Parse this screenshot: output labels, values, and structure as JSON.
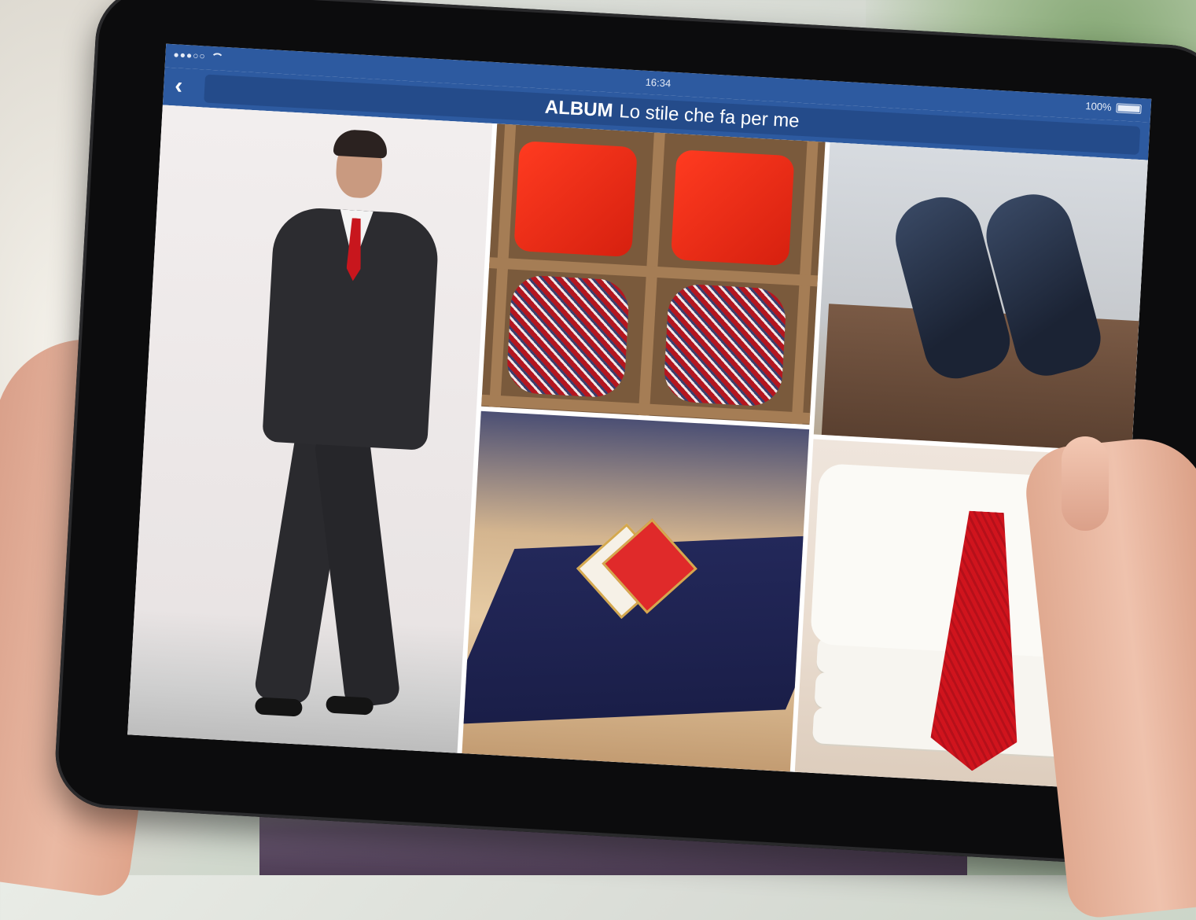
{
  "status_bar": {
    "signal": "●●●○○",
    "time": "16:34",
    "battery_label": "100%",
    "battery_level": 1.0
  },
  "nav": {
    "back_icon": "chevron-left-icon",
    "title_strong": "ALBUM",
    "title_rest": "Lo stile che fa per me"
  },
  "gallery": {
    "tiles": [
      {
        "subject": "man-in-suit"
      },
      {
        "subject": "ties"
      },
      {
        "subject": "shoes"
      },
      {
        "subject": "pin"
      },
      {
        "subject": "shirts-with-tie"
      }
    ]
  },
  "colors": {
    "nav_blue": "#2d5aa0",
    "title_pill_blue": "#244b8a",
    "accent_red": "#c8161d"
  }
}
